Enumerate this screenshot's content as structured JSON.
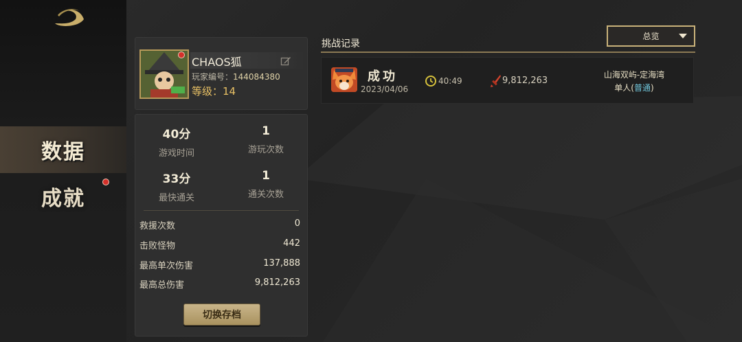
{
  "sidebar": {
    "items": [
      {
        "label": "数据",
        "selected": true
      },
      {
        "label": "成就",
        "has_notification": true
      }
    ]
  },
  "player": {
    "name": "CHAOS狐",
    "id_label": "玩家编号：",
    "id_value": "144084380",
    "level_label": "等级：",
    "level_value": "14",
    "avatar_icon": "witch-character-avatar"
  },
  "stats": {
    "grid": [
      {
        "value": "40分",
        "label": "游戏时间"
      },
      {
        "value": "1",
        "label": "游玩次数"
      },
      {
        "value": "33分",
        "label": "最快通关"
      },
      {
        "value": "1",
        "label": "通关次数"
      }
    ],
    "rows": [
      {
        "label": "救援次数",
        "value": "0"
      },
      {
        "label": "击败怪物",
        "value": "442"
      },
      {
        "label": "最高单次伤害",
        "value": "137,888"
      },
      {
        "label": "最高总伤害",
        "value": "9,812,263"
      }
    ],
    "switch_button": "切换存档"
  },
  "records": {
    "title": "挑战记录",
    "filter": {
      "selected": "总览"
    },
    "items": [
      {
        "result": "成功",
        "date": "2023/04/06",
        "time": "40:49",
        "damage": "9,812,263",
        "map": "山海双屿-定海湾",
        "mode_prefix": "单人(",
        "difficulty": "普通",
        "mode_suffix": ")",
        "avatar_icon": "fox-character-avatar"
      }
    ]
  },
  "colors": {
    "accent_gold": "#c9b27a",
    "level_color": "#e8c064",
    "difficulty_color": "#6fc4d9",
    "notification_red": "#d4302a"
  }
}
